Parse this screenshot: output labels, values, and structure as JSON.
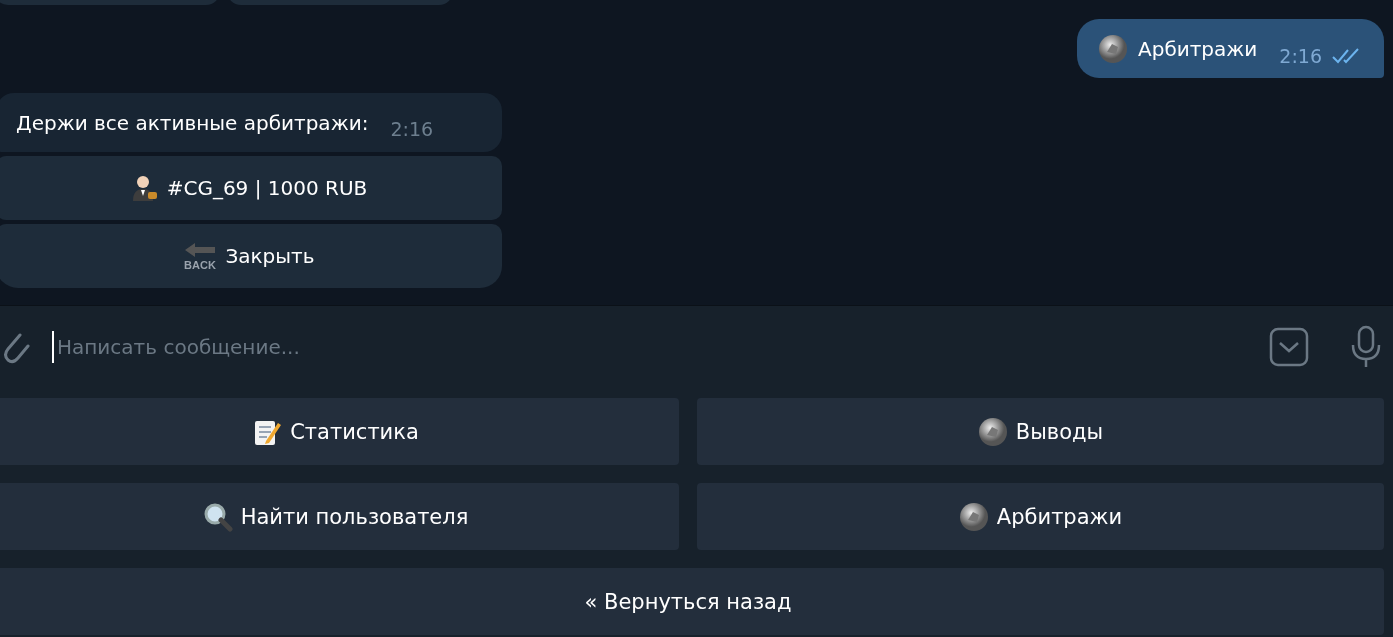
{
  "previous_message": {
    "buttons": [
      {
        "kind": "inline-button"
      },
      {
        "kind": "inline-button"
      }
    ]
  },
  "messages": [
    {
      "kind": "outgoing",
      "text": "Арбитражи",
      "time": "2:16",
      "read": true
    },
    {
      "kind": "incoming",
      "text": "Держи все активные арбитражи:",
      "time": "2:16",
      "buttons": [
        {
          "kind": "person",
          "label": "#CG_69 | 1000 RUB"
        },
        {
          "kind": "back",
          "icon_text": "BACK",
          "label": "Закрыть"
        }
      ]
    }
  ],
  "composer": {
    "placeholder": "Написать сообщение..."
  },
  "keyboard": {
    "rows": [
      [
        {
          "kind": "memo",
          "label": "Статистика"
        },
        {
          "kind": "coin",
          "label": "Выводы"
        }
      ],
      [
        {
          "kind": "magnifier",
          "label": "Найти пользователя"
        },
        {
          "kind": "coin",
          "label": "Арбитражи"
        }
      ],
      [
        {
          "kind": "plain",
          "label": "« Вернуться назад"
        }
      ]
    ]
  }
}
